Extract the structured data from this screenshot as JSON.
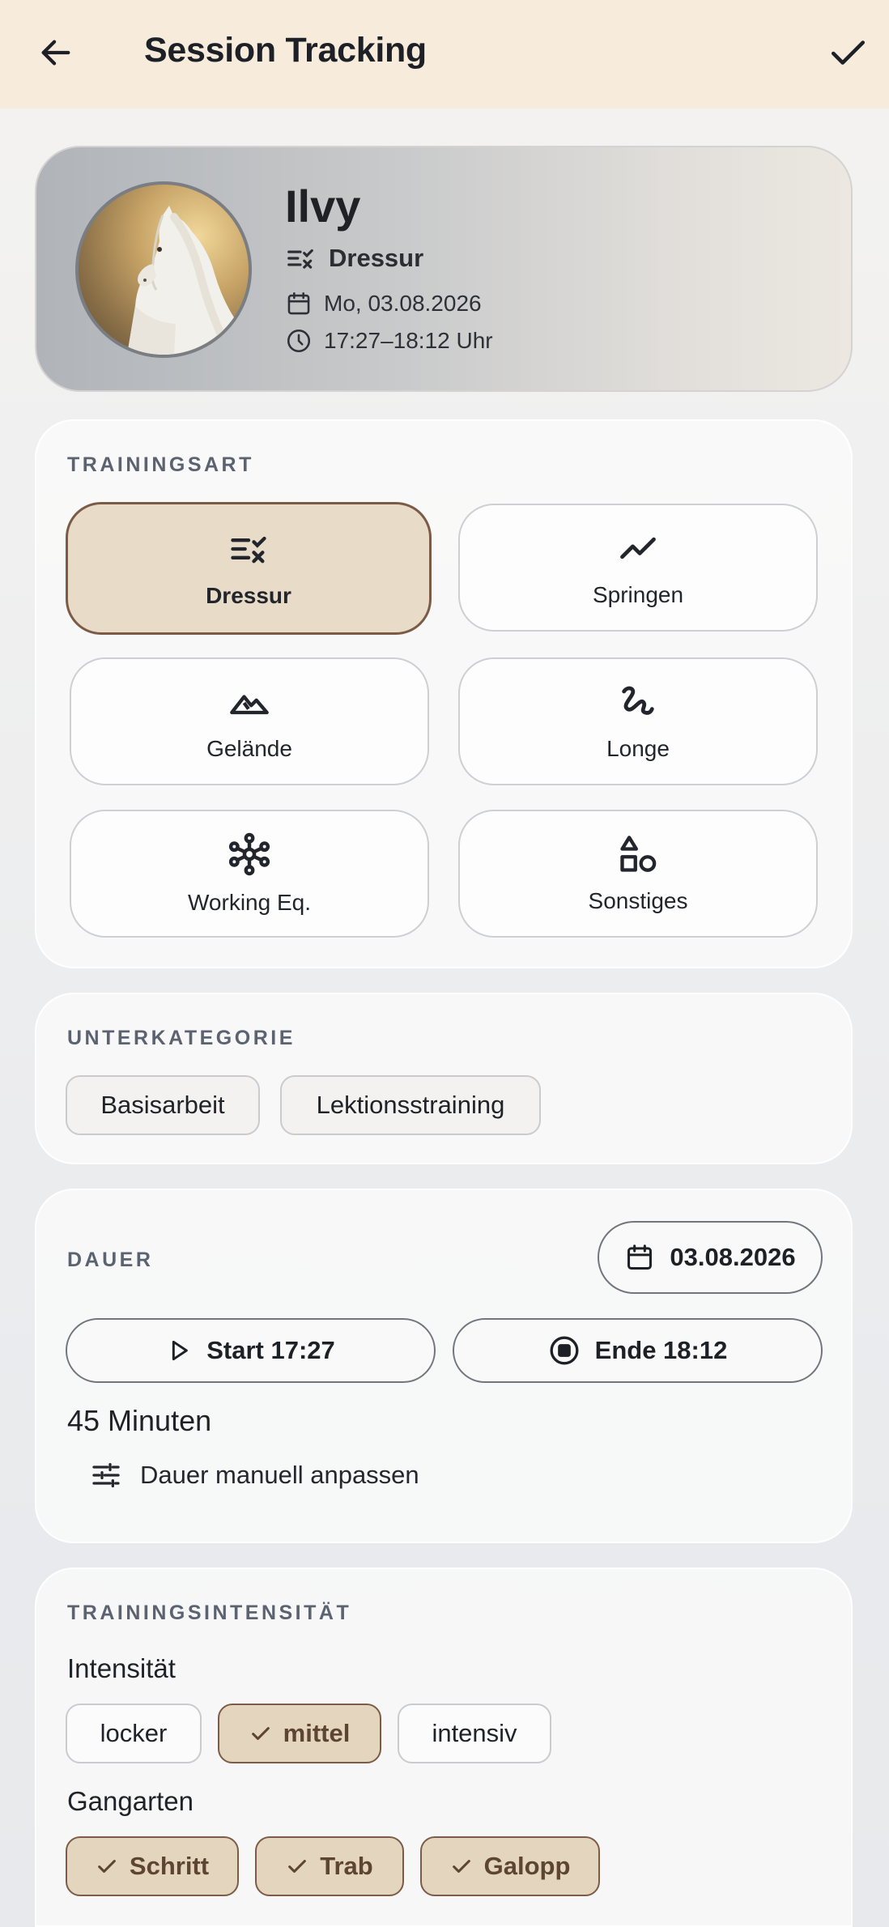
{
  "header": {
    "title": "Session Tracking",
    "back_icon": "arrow-left-icon",
    "confirm_icon": "check-icon"
  },
  "horse": {
    "name": "Ilvy",
    "discipline": "Dressur",
    "date": "Mo, 03.08.2026",
    "time": "17:27–18:12 Uhr"
  },
  "training_type": {
    "label": "TRAININGSART",
    "options": [
      {
        "label": "Dressur",
        "icon": "dressage-icon",
        "selected": true
      },
      {
        "label": "Springen",
        "icon": "trend-line-icon",
        "selected": false
      },
      {
        "label": "Gelände",
        "icon": "terrain-icon",
        "selected": false
      },
      {
        "label": "Longe",
        "icon": "lunge-curve-icon",
        "selected": false
      },
      {
        "label": "Working Eq.",
        "icon": "hub-network-icon",
        "selected": false
      },
      {
        "label": "Sonstiges",
        "icon": "shapes-icon",
        "selected": false
      }
    ]
  },
  "subcategory": {
    "label": "UNTERKATEGORIE",
    "options": [
      "Basisarbeit",
      "Lektionsstraining"
    ]
  },
  "duration": {
    "label": "DAUER",
    "date": "03.08.2026",
    "start": "Start 17:27",
    "end": "Ende 18:12",
    "minutes": "45 Minuten",
    "manual": "Dauer manuell anpassen"
  },
  "intensity": {
    "label": "TRAININGSINTENSITÄT",
    "intensity_label": "Intensität",
    "intensity_options": [
      {
        "label": "locker",
        "selected": false
      },
      {
        "label": "mittel",
        "selected": true
      },
      {
        "label": "intensiv",
        "selected": false
      }
    ],
    "gaits_label": "Gangarten",
    "gaits": [
      {
        "label": "Schritt",
        "selected": true
      },
      {
        "label": "Trab",
        "selected": true
      },
      {
        "label": "Galopp",
        "selected": true
      }
    ]
  },
  "colors": {
    "appbar": "#f7ecdc",
    "selected_fill": "#e8dcc9",
    "selected_border": "#7b5b45"
  }
}
